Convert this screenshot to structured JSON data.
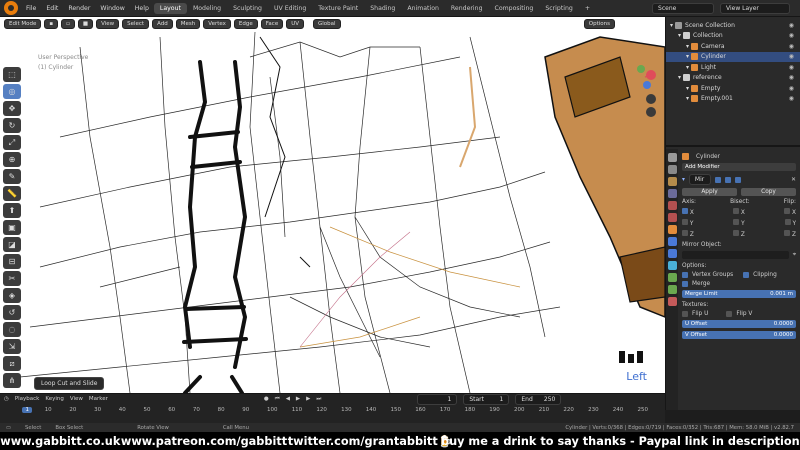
{
  "topbar": {
    "menus": [
      "File",
      "Edit",
      "Render",
      "Window",
      "Help"
    ],
    "workspaces": [
      "Layout",
      "Modeling",
      "Sculpting",
      "UV Editing",
      "Texture Paint",
      "Shading",
      "Animation",
      "Rendering",
      "Compositing",
      "Scripting"
    ],
    "active_workspace": "Layout",
    "add_tab": "+",
    "scene": "Scene",
    "view_layer": "View Layer"
  },
  "viewport": {
    "mode": "Edit Mode",
    "header_menus": [
      "View",
      "Select",
      "Add",
      "Mesh",
      "Vertex",
      "Edge",
      "Face",
      "UV"
    ],
    "transform": "Global",
    "options": "Options",
    "perspective": "User Perspective",
    "object": "(1) Cylinder",
    "operator": "Loop Cut and Slide",
    "view_name": "Left",
    "accent": "#e87d0d"
  },
  "toolbar": {
    "tools": [
      "select-icon",
      "cursor-icon",
      "move-icon",
      "rotate-icon",
      "scale-icon",
      "transform-icon",
      "annotate-icon",
      "measure-icon",
      "extrude-icon",
      "inset-icon",
      "bevel-icon",
      "loopcut-icon",
      "knife-icon",
      "polybuild-icon",
      "spin-icon",
      "smooth-icon",
      "shrink-icon",
      "shear-icon",
      "rip-icon"
    ],
    "active_index": 1
  },
  "outliner": {
    "rows": [
      {
        "label": "Scene Collection",
        "indent": 0,
        "color": "#9a9a9a"
      },
      {
        "label": "Collection",
        "indent": 1,
        "color": "#cfcfcf"
      },
      {
        "label": "Camera",
        "indent": 2,
        "color": "#e28c3c"
      },
      {
        "label": "Cylinder",
        "indent": 2,
        "color": "#e28c3c"
      },
      {
        "label": "Light",
        "indent": 2,
        "color": "#e28c3c"
      },
      {
        "label": "reference",
        "indent": 1,
        "color": "#cfcfcf"
      },
      {
        "label": "Empty",
        "indent": 2,
        "color": "#e28c3c"
      },
      {
        "label": "Empty.001",
        "indent": 2,
        "color": "#e28c3c"
      }
    ],
    "selected_index": 3
  },
  "properties": {
    "object": "Cylinder",
    "add_modifier": "Add Modifier",
    "modifier_name": "Mir",
    "apply": "Apply",
    "copy": "Copy",
    "axis_label": "Axis:",
    "bisect_label": "Bisect:",
    "flip_label": "Flip:",
    "axes": [
      "X",
      "Y",
      "Z"
    ],
    "mirror_object": "Mirror Object:",
    "options_label": "Options:",
    "vertex_groups": "Vertex Groups",
    "clipping": "Clipping",
    "merge": "Merge",
    "merge_limit_label": "Merge Limit",
    "merge_limit_value": "0.001 m",
    "textures_label": "Textures:",
    "flip_u": "Flip U",
    "flip_v": "Flip V",
    "u_offset_label": "U Offset",
    "u_offset_value": "0.0000",
    "v_offset_label": "V Offset",
    "v_offset_value": "0.0000"
  },
  "timeline": {
    "menus": [
      "Playback",
      "Keying",
      "View",
      "Marker"
    ],
    "current_frame": "1",
    "start_label": "Start",
    "start_value": "1",
    "end_label": "End",
    "end_value": "250",
    "ticks": [
      "1",
      "10",
      "20",
      "30",
      "40",
      "50",
      "60",
      "70",
      "80",
      "90",
      "100",
      "110",
      "120",
      "130",
      "140",
      "150",
      "160",
      "170",
      "180",
      "190",
      "200",
      "210",
      "220",
      "230",
      "240",
      "250"
    ]
  },
  "statusbar": {
    "items": [
      "Select",
      "Box Select",
      "Rotate View",
      "Call Menu"
    ],
    "stats": "Cylinder | Verts:0/368 | Edges:0/719 | Faces:0/352 | Tris:687 | Mem: 58.0 MiB | v2.82.7"
  },
  "banner": {
    "links": [
      "www.gabbitt.co.uk",
      "www.patreon.com/gabbitt",
      "twitter.com/grantabbitt",
      "buy me a drink to say thanks - Paypal link in description"
    ]
  }
}
